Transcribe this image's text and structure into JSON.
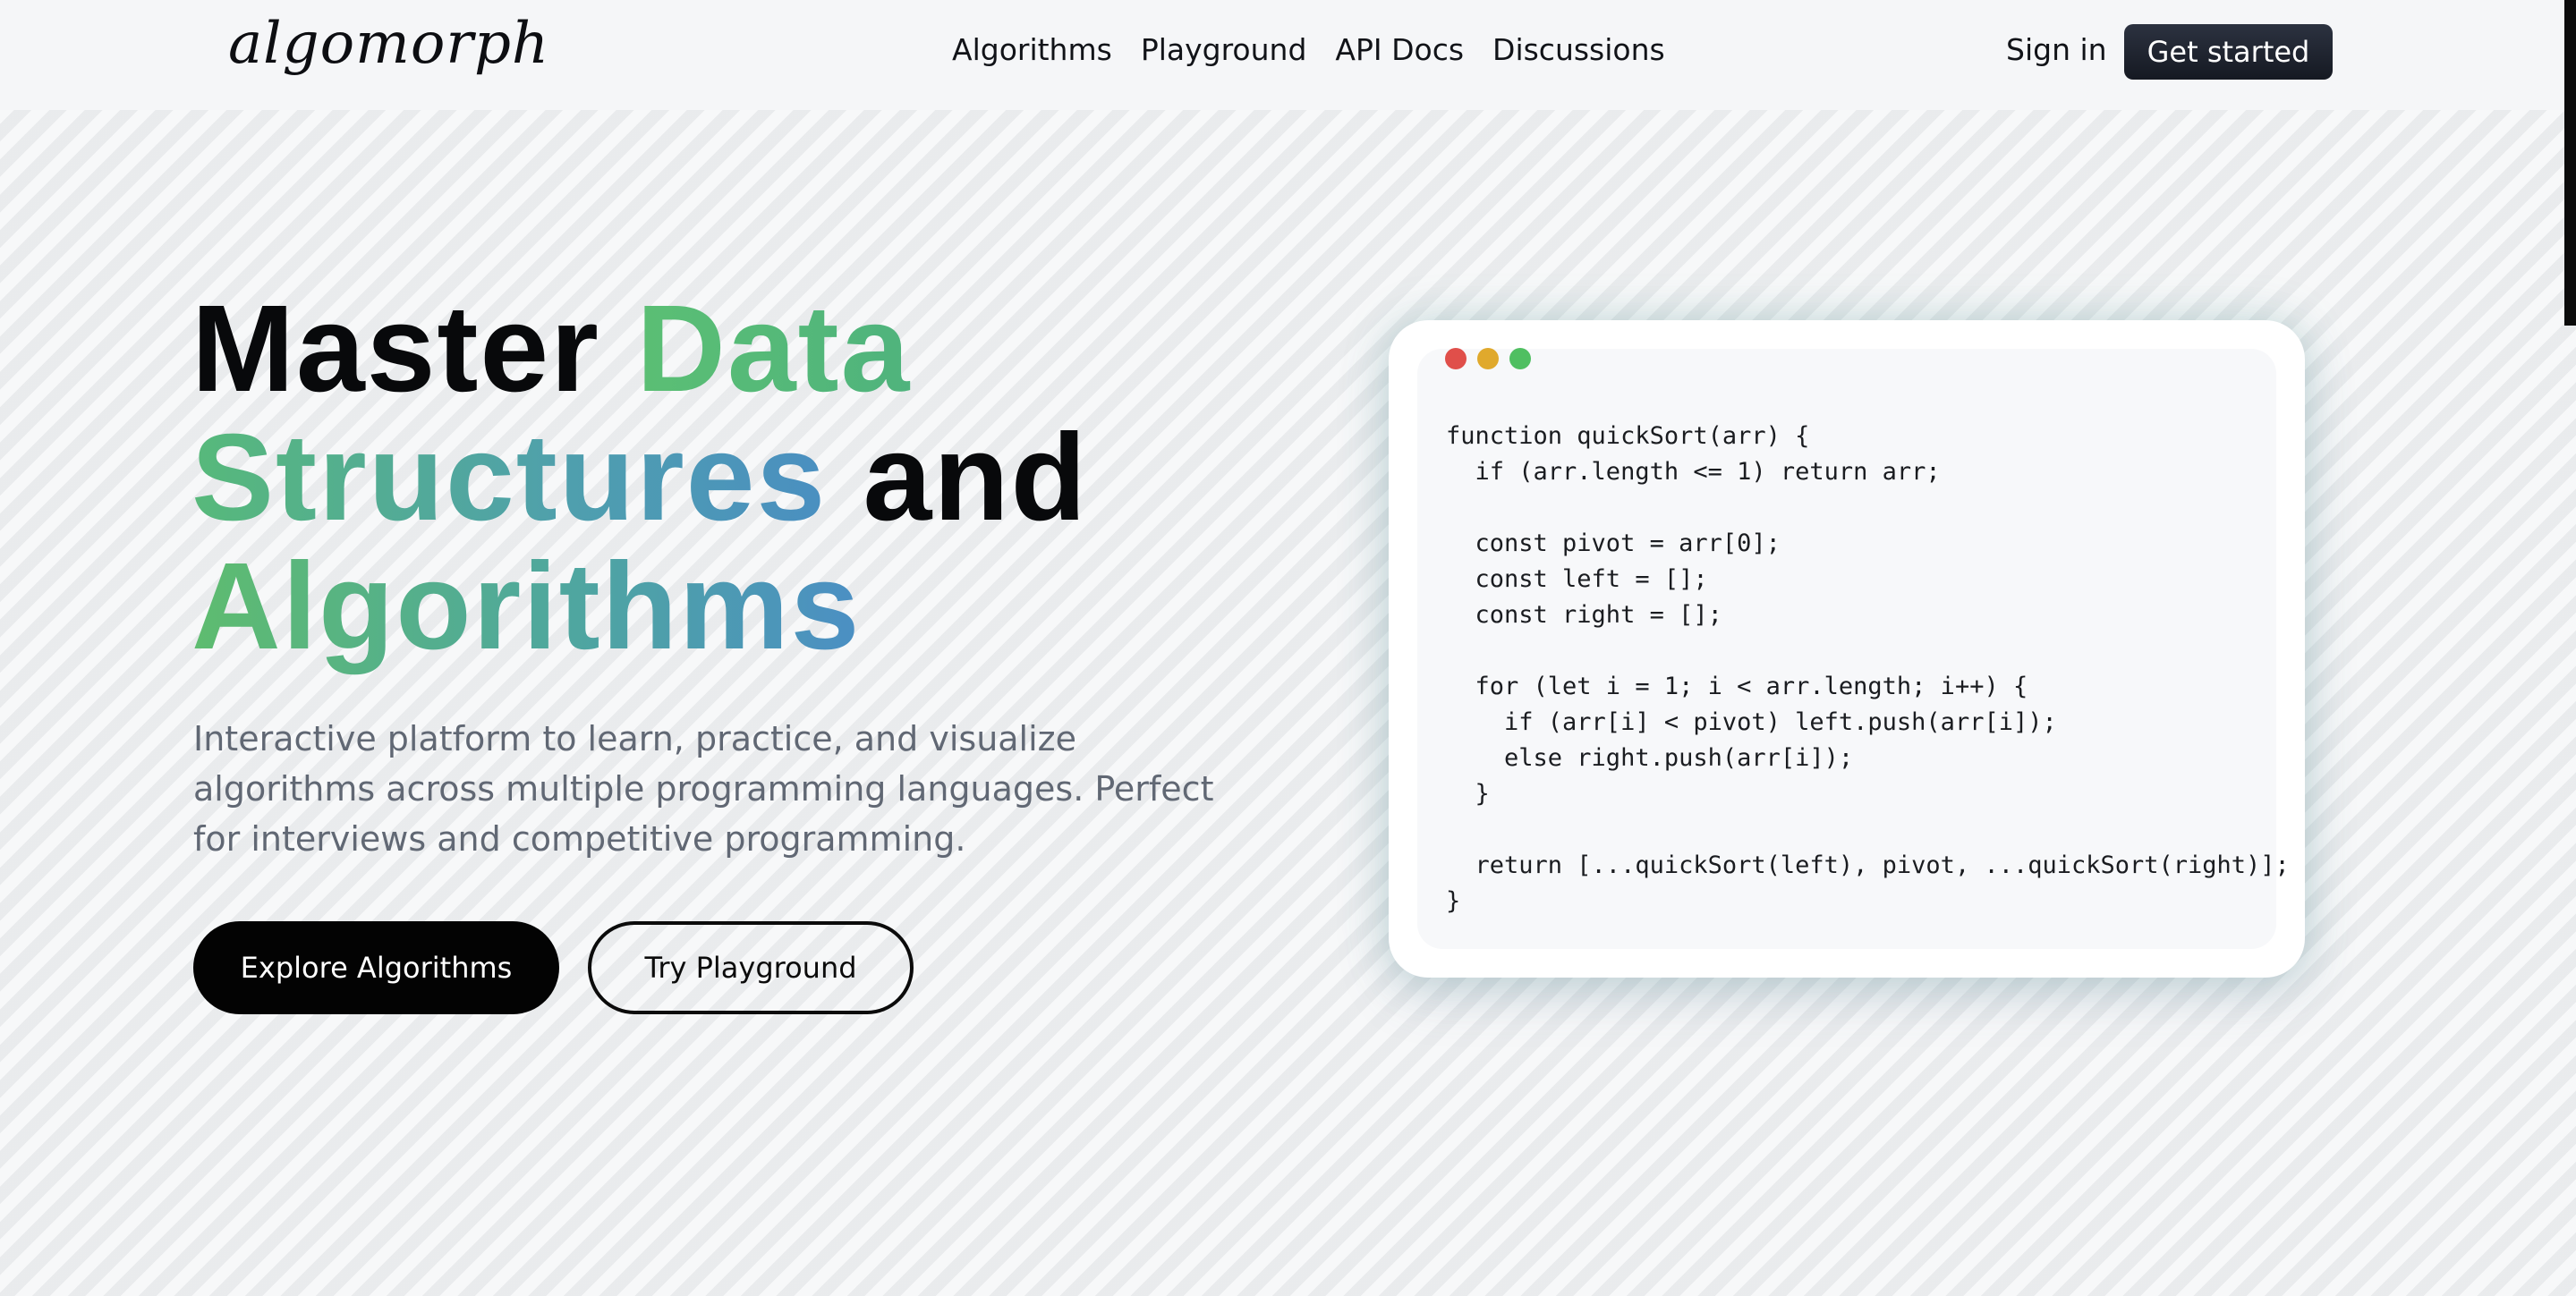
{
  "header": {
    "logo": "algomorph",
    "nav": [
      {
        "label": "Algorithms"
      },
      {
        "label": "Playground"
      },
      {
        "label": "API Docs"
      },
      {
        "label": "Discussions"
      }
    ],
    "sign_in": "Sign in",
    "get_started": "Get started"
  },
  "hero": {
    "title": {
      "part1": "Master ",
      "part2": "Data",
      "part3": "Structures",
      "part4": " and",
      "part5": "Algorithms"
    },
    "subtitle": "Interactive platform to learn, practice, and visualize algorithms across multiple programming languages. Perfect for interviews and competitive programming.",
    "primary_button": "Explore Algorithms",
    "secondary_button": "Try Playground"
  },
  "code_window": {
    "dot_colors": [
      "#e04f4a",
      "#e0a92c",
      "#4fbf61"
    ],
    "lines": [
      "function quickSort(arr) {",
      "  if (arr.length <= 1) return arr;",
      "",
      "  const pivot = arr[0];",
      "  const left = [];",
      "  const right = [];",
      "",
      "  for (let i = 1; i < arr.length; i++) {",
      "    if (arr[i] < pivot) left.push(arr[i]);",
      "    else right.push(arr[i]);",
      "  }",
      "",
      "  return [...quickSort(left), pivot, ...quickSort(right)];",
      "}"
    ]
  }
}
